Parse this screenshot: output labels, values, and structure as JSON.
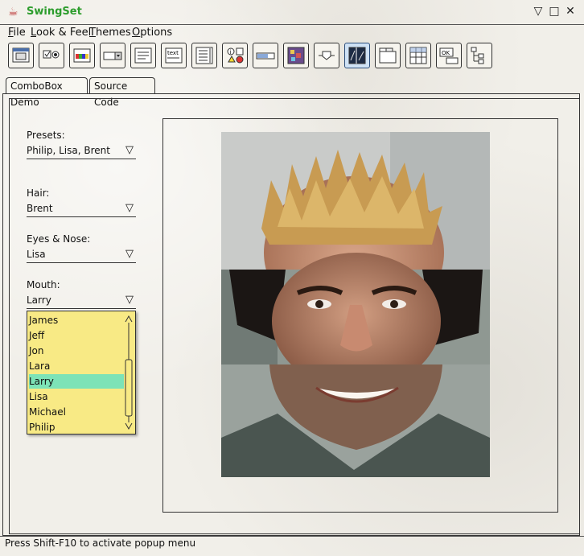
{
  "window": {
    "title": "SwingSet"
  },
  "menu": [
    "File",
    "Look & Feel",
    "Themes",
    "Options"
  ],
  "toolbar": {
    "buttons": [
      "internal-frame-demo",
      "button-demo",
      "color-chooser-demo",
      "combobox-demo",
      "file-chooser-demo",
      "html-demo",
      "list-demo",
      "option-pane-demo",
      "progress-bar-demo",
      "scroll-pane-demo",
      "slider-demo",
      "split-pane-demo",
      "tabbed-pane-demo",
      "table-demo",
      "tooltip-demo",
      "tree-demo"
    ],
    "selected": "split-pane-demo"
  },
  "tabs": [
    "ComboBox Demo",
    "Source Code"
  ],
  "presets": {
    "label": "Presets:",
    "value": "Philip, Lisa, Brent"
  },
  "hair": {
    "label": "Hair:",
    "value": "Brent"
  },
  "eyes": {
    "label": "Eyes & Nose:",
    "value": "Lisa"
  },
  "mouth": {
    "label": "Mouth:",
    "value": "Larry"
  },
  "mouth_options": [
    "James",
    "Jeff",
    "Jon",
    "Lara",
    "Larry",
    "Lisa",
    "Michael",
    "Philip"
  ],
  "mouth_selected": "Larry",
  "status": "Press Shift-F10 to activate popup menu",
  "colors": {
    "popup_bg": "#f8ea85",
    "popup_selection": "#7de3b7",
    "title_green": "#2d9d2d"
  }
}
